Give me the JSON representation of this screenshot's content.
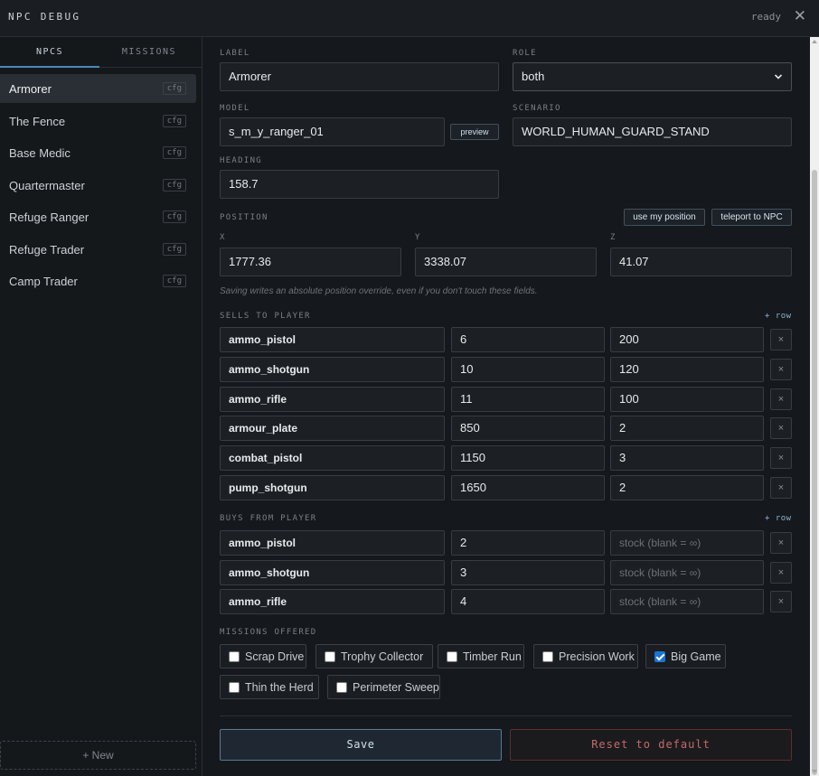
{
  "header": {
    "title": "NPC DEBUG",
    "status": "ready",
    "close_icon": "close-icon"
  },
  "sidebar": {
    "tabs": [
      {
        "label": "NPCS",
        "active": true
      },
      {
        "label": "MISSIONS",
        "active": false
      }
    ],
    "items": [
      {
        "label": "Armorer",
        "badge": "cfg",
        "active": true
      },
      {
        "label": "The Fence",
        "badge": "cfg"
      },
      {
        "label": "Base Medic",
        "badge": "cfg"
      },
      {
        "label": "Quartermaster",
        "badge": "cfg"
      },
      {
        "label": "Refuge Ranger",
        "badge": "cfg"
      },
      {
        "label": "Refuge Trader",
        "badge": "cfg"
      },
      {
        "label": "Camp Trader",
        "badge": "cfg"
      }
    ],
    "new_label": "+ New"
  },
  "form": {
    "label": {
      "label": "LABEL",
      "value": "Armorer"
    },
    "role": {
      "label": "ROLE",
      "value": "both"
    },
    "model": {
      "label": "MODEL",
      "value": "s_m_y_ranger_01",
      "preview_label": "preview"
    },
    "scenario": {
      "label": "SCENARIO",
      "value": "WORLD_HUMAN_GUARD_STAND"
    },
    "heading": {
      "label": "HEADING",
      "value": "158.7"
    },
    "position": {
      "label": "POSITION",
      "use_my_position": "use my position",
      "teleport": "teleport to NPC",
      "x_label": "X",
      "x": "1777.36",
      "y_label": "Y",
      "y": "3338.07",
      "z_label": "Z",
      "z": "41.07",
      "hint": "Saving writes an absolute position override, even if you don't touch these fields."
    },
    "sells": {
      "label": "SELLS TO PLAYER",
      "add_row": "+ row",
      "rows": [
        {
          "item": "ammo_pistol",
          "price": "6",
          "stock": "200"
        },
        {
          "item": "ammo_shotgun",
          "price": "10",
          "stock": "120"
        },
        {
          "item": "ammo_rifle",
          "price": "11",
          "stock": "100"
        },
        {
          "item": "armour_plate",
          "price": "850",
          "stock": "2"
        },
        {
          "item": "combat_pistol",
          "price": "1150",
          "stock": "3"
        },
        {
          "item": "pump_shotgun",
          "price": "1650",
          "stock": "2"
        }
      ],
      "remove_label": "×"
    },
    "buys": {
      "label": "BUYS FROM PLAYER",
      "add_row": "+ row",
      "stock_placeholder": "stock (blank = ∞)",
      "rows": [
        {
          "item": "ammo_pistol",
          "price": "2"
        },
        {
          "item": "ammo_shotgun",
          "price": "3"
        },
        {
          "item": "ammo_rifle",
          "price": "4"
        }
      ],
      "remove_label": "×"
    },
    "missions": {
      "label": "MISSIONS OFFERED",
      "options": [
        {
          "label": "Scrap Drive",
          "checked": false
        },
        {
          "label": "Trophy Collector",
          "checked": false
        },
        {
          "label": "Timber Run",
          "checked": false
        },
        {
          "label": "Precision Work",
          "checked": false
        },
        {
          "label": "Big Game",
          "checked": true
        },
        {
          "label": "Thin the Herd",
          "checked": false
        },
        {
          "label": "Perimeter Sweep",
          "checked": false
        }
      ]
    },
    "save_label": "Save",
    "reset_label": "Reset to default"
  },
  "colors": {
    "accent": "#4a89b8",
    "danger": "#c46a6a",
    "background": "#15181c"
  }
}
